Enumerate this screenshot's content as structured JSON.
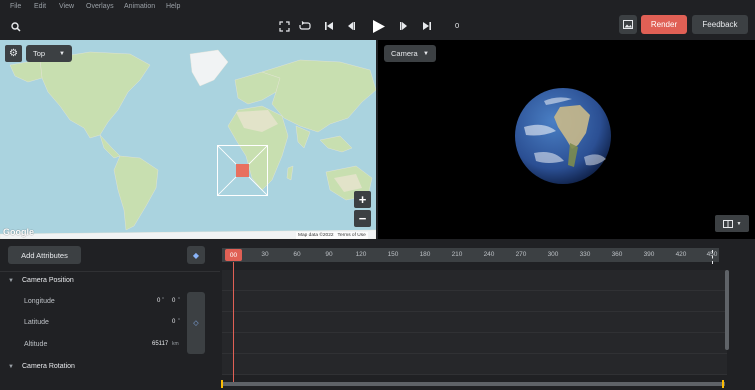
{
  "menu": [
    "File",
    "Edit",
    "View",
    "Overlays",
    "Animation",
    "Help"
  ],
  "toolbar": {
    "frame": "0",
    "render_label": "Render",
    "feedback_label": "Feedback"
  },
  "map": {
    "view_label": "Top",
    "attribution": "Map data ©2022",
    "terms": "Terms of Use",
    "logo": "Google"
  },
  "camera": {
    "view_label": "Camera"
  },
  "timeline": {
    "add_attributes_label": "Add Attributes",
    "current_frame": "00",
    "ticks": [
      "30",
      "60",
      "90",
      "120",
      "150",
      "180",
      "210",
      "240",
      "270",
      "300",
      "330",
      "360",
      "390",
      "420",
      "450"
    ]
  },
  "attributes": {
    "camera_position_label": "Camera Position",
    "longitude_label": "Longitude",
    "longitude_values": [
      "0",
      "0"
    ],
    "latitude_label": "Latitude",
    "latitude_value": "0",
    "altitude_label": "Altitude",
    "altitude_value": "65117",
    "altitude_unit": "km",
    "camera_rotation_label": "Camera Rotation"
  },
  "colors": {
    "accent": "#e06055",
    "bg": "#202124",
    "panel": "#3c4043",
    "map_water": "#aad3df",
    "map_land": "#c8dfb0"
  }
}
